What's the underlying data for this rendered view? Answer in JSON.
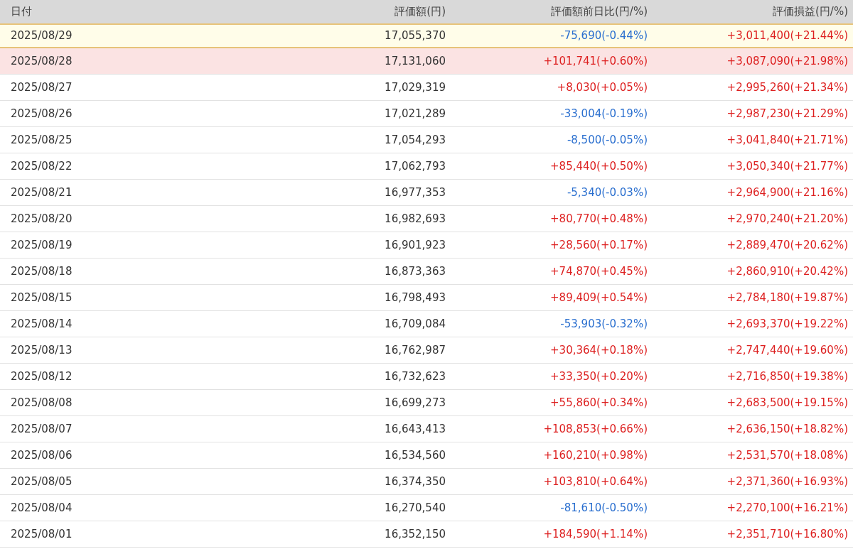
{
  "table": {
    "columns": [
      "日付",
      "評価額(円)",
      "評価額前日比(円/%)",
      "評価損益(円/%)"
    ],
    "rows": [
      {
        "date": "2025/08/29",
        "value": "17,055,370",
        "change": {
          "text": "-75,690(-0.44%)",
          "color": "#2a6fcf"
        },
        "profit": {
          "text": "+3,011,400(+21.44%)",
          "color": "#dd1f1f"
        },
        "selected": true,
        "highlighted": false
      },
      {
        "date": "2025/08/28",
        "value": "17,131,060",
        "change": {
          "text": "+101,741(+0.60%)",
          "color": "#dd1f1f"
        },
        "profit": {
          "text": "+3,087,090(+21.98%)",
          "color": "#dd1f1f"
        },
        "selected": false,
        "highlighted": true
      },
      {
        "date": "2025/08/27",
        "value": "17,029,319",
        "change": {
          "text": "+8,030(+0.05%)",
          "color": "#dd1f1f"
        },
        "profit": {
          "text": "+2,995,260(+21.34%)",
          "color": "#dd1f1f"
        },
        "selected": false,
        "highlighted": false
      },
      {
        "date": "2025/08/26",
        "value": "17,021,289",
        "change": {
          "text": "-33,004(-0.19%)",
          "color": "#2a6fcf"
        },
        "profit": {
          "text": "+2,987,230(+21.29%)",
          "color": "#dd1f1f"
        },
        "selected": false,
        "highlighted": false
      },
      {
        "date": "2025/08/25",
        "value": "17,054,293",
        "change": {
          "text": "-8,500(-0.05%)",
          "color": "#2a6fcf"
        },
        "profit": {
          "text": "+3,041,840(+21.71%)",
          "color": "#dd1f1f"
        },
        "selected": false,
        "highlighted": false
      },
      {
        "date": "2025/08/22",
        "value": "17,062,793",
        "change": {
          "text": "+85,440(+0.50%)",
          "color": "#dd1f1f"
        },
        "profit": {
          "text": "+3,050,340(+21.77%)",
          "color": "#dd1f1f"
        },
        "selected": false,
        "highlighted": false
      },
      {
        "date": "2025/08/21",
        "value": "16,977,353",
        "change": {
          "text": "-5,340(-0.03%)",
          "color": "#2a6fcf"
        },
        "profit": {
          "text": "+2,964,900(+21.16%)",
          "color": "#dd1f1f"
        },
        "selected": false,
        "highlighted": false
      },
      {
        "date": "2025/08/20",
        "value": "16,982,693",
        "change": {
          "text": "+80,770(+0.48%)",
          "color": "#dd1f1f"
        },
        "profit": {
          "text": "+2,970,240(+21.20%)",
          "color": "#dd1f1f"
        },
        "selected": false,
        "highlighted": false
      },
      {
        "date": "2025/08/19",
        "value": "16,901,923",
        "change": {
          "text": "+28,560(+0.17%)",
          "color": "#dd1f1f"
        },
        "profit": {
          "text": "+2,889,470(+20.62%)",
          "color": "#dd1f1f"
        },
        "selected": false,
        "highlighted": false
      },
      {
        "date": "2025/08/18",
        "value": "16,873,363",
        "change": {
          "text": "+74,870(+0.45%)",
          "color": "#dd1f1f"
        },
        "profit": {
          "text": "+2,860,910(+20.42%)",
          "color": "#dd1f1f"
        },
        "selected": false,
        "highlighted": false
      },
      {
        "date": "2025/08/15",
        "value": "16,798,493",
        "change": {
          "text": "+89,409(+0.54%)",
          "color": "#dd1f1f"
        },
        "profit": {
          "text": "+2,784,180(+19.87%)",
          "color": "#dd1f1f"
        },
        "selected": false,
        "highlighted": false
      },
      {
        "date": "2025/08/14",
        "value": "16,709,084",
        "change": {
          "text": "-53,903(-0.32%)",
          "color": "#2a6fcf"
        },
        "profit": {
          "text": "+2,693,370(+19.22%)",
          "color": "#dd1f1f"
        },
        "selected": false,
        "highlighted": false
      },
      {
        "date": "2025/08/13",
        "value": "16,762,987",
        "change": {
          "text": "+30,364(+0.18%)",
          "color": "#dd1f1f"
        },
        "profit": {
          "text": "+2,747,440(+19.60%)",
          "color": "#dd1f1f"
        },
        "selected": false,
        "highlighted": false
      },
      {
        "date": "2025/08/12",
        "value": "16,732,623",
        "change": {
          "text": "+33,350(+0.20%)",
          "color": "#dd1f1f"
        },
        "profit": {
          "text": "+2,716,850(+19.38%)",
          "color": "#dd1f1f"
        },
        "selected": false,
        "highlighted": false
      },
      {
        "date": "2025/08/08",
        "value": "16,699,273",
        "change": {
          "text": "+55,860(+0.34%)",
          "color": "#dd1f1f"
        },
        "profit": {
          "text": "+2,683,500(+19.15%)",
          "color": "#dd1f1f"
        },
        "selected": false,
        "highlighted": false
      },
      {
        "date": "2025/08/07",
        "value": "16,643,413",
        "change": {
          "text": "+108,853(+0.66%)",
          "color": "#dd1f1f"
        },
        "profit": {
          "text": "+2,636,150(+18.82%)",
          "color": "#dd1f1f"
        },
        "selected": false,
        "highlighted": false
      },
      {
        "date": "2025/08/06",
        "value": "16,534,560",
        "change": {
          "text": "+160,210(+0.98%)",
          "color": "#dd1f1f"
        },
        "profit": {
          "text": "+2,531,570(+18.08%)",
          "color": "#dd1f1f"
        },
        "selected": false,
        "highlighted": false
      },
      {
        "date": "2025/08/05",
        "value": "16,374,350",
        "change": {
          "text": "+103,810(+0.64%)",
          "color": "#dd1f1f"
        },
        "profit": {
          "text": "+2,371,360(+16.93%)",
          "color": "#dd1f1f"
        },
        "selected": false,
        "highlighted": false
      },
      {
        "date": "2025/08/04",
        "value": "16,270,540",
        "change": {
          "text": "-81,610(-0.50%)",
          "color": "#2a6fcf"
        },
        "profit": {
          "text": "+2,270,100(+16.21%)",
          "color": "#dd1f1f"
        },
        "selected": false,
        "highlighted": false
      },
      {
        "date": "2025/08/01",
        "value": "16,352,150",
        "change": {
          "text": "+184,590(+1.14%)",
          "color": "#dd1f1f"
        },
        "profit": {
          "text": "+2,351,710(+16.80%)",
          "color": "#dd1f1f"
        },
        "selected": false,
        "highlighted": false
      }
    ]
  }
}
